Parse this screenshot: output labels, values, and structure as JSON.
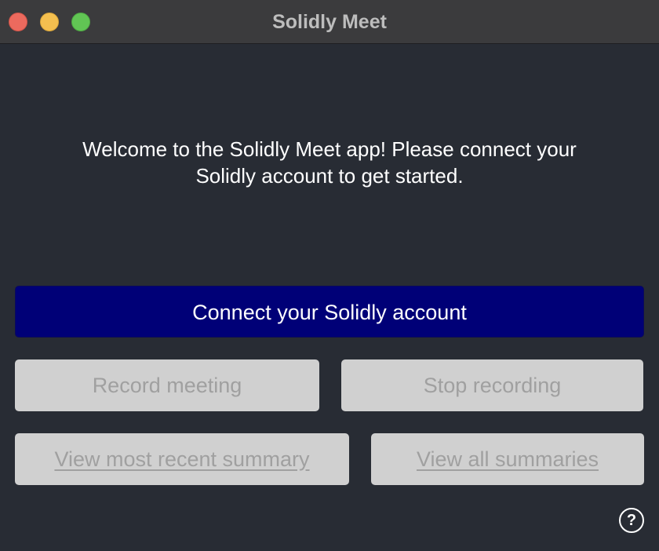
{
  "window": {
    "title": "Solidly Meet"
  },
  "welcome": {
    "line1": "Welcome to the Solidly Meet app! Please connect your",
    "line2": "Solidly account to get started."
  },
  "buttons": {
    "connect_label": "Connect your Solidly account",
    "record_label": "Record meeting",
    "stop_label": "Stop recording",
    "recent_summary_label": "View most recent summary",
    "all_summaries_label": "View all summaries"
  },
  "help": {
    "glyph": "?"
  },
  "colors": {
    "background": "#282c34",
    "titlebar": "#3b3b3d",
    "primary_button": "#000077",
    "disabled_button": "#d0d0d0",
    "disabled_text": "#a0a0a0"
  },
  "icons": {
    "close": "close-icon",
    "minimize": "minimize-icon",
    "zoom": "zoom-icon",
    "help": "help-icon"
  }
}
